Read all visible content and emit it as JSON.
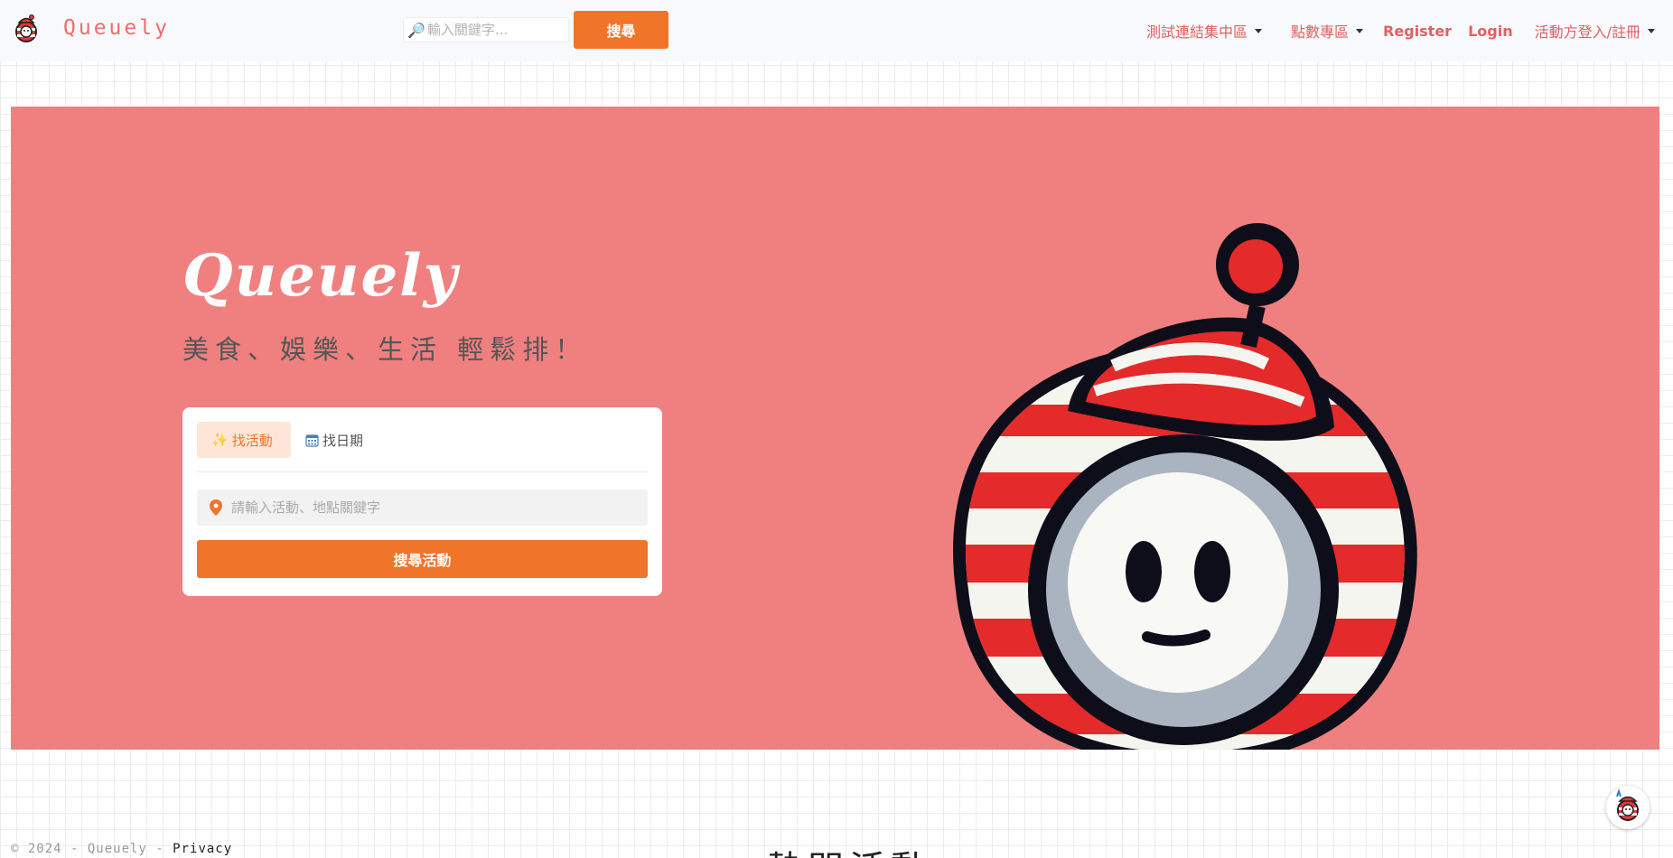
{
  "brand": {
    "name": "Queuely"
  },
  "header_search": {
    "placeholder": "輸入關鍵字...",
    "button_label": "搜尋"
  },
  "nav": {
    "test_links": "測試連結集中區",
    "points": "點數專區",
    "register": "Register",
    "login": "Login",
    "organizer": "活動方登入/註冊"
  },
  "hero": {
    "title": "Queuely",
    "subtitle": "美食、娛樂、生活 輕鬆排！",
    "tabs": [
      {
        "icon": "sparkles-icon",
        "label": "找活動"
      },
      {
        "icon": "calendar-icon",
        "label": "找日期"
      }
    ],
    "location_placeholder": "請輸入活動、地點關鍵字",
    "search_button": "搜尋活動"
  },
  "footer": {
    "copyright": "© 2024 - Queuely - ",
    "privacy": "Privacy"
  },
  "section": {
    "heading": "熱門活動"
  },
  "colors": {
    "accent": "#f1742b",
    "hero_bg": "#f08080",
    "brand": "#ef6d6d"
  }
}
